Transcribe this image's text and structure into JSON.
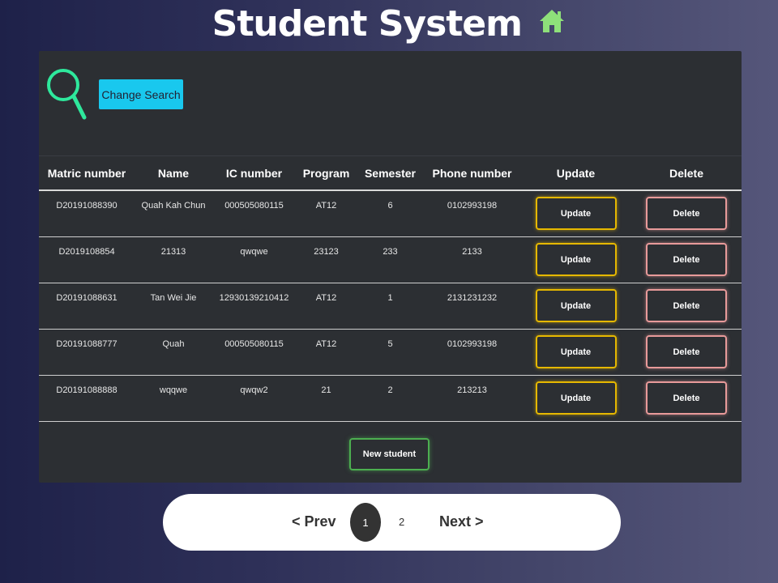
{
  "header": {
    "title": "Student System",
    "icon": "home-icon",
    "icon_color": "#8ee07a"
  },
  "search": {
    "button_label": "Change Search",
    "icon": "search-icon",
    "icon_color": "#2ee89c",
    "button_color": "#19c8ee"
  },
  "table": {
    "columns": [
      "Matric number",
      "Name",
      "IC number",
      "Program",
      "Semester",
      "Phone number",
      "Update",
      "Delete"
    ],
    "rows": [
      {
        "matric": "D20191088390",
        "name": "Quah Kah Chun",
        "ic": "000505080115",
        "program": "AT12",
        "semester": "6",
        "phone": "0102993198",
        "update_label": "Update",
        "delete_label": "Delete"
      },
      {
        "matric": "D2019108854",
        "name": "21313",
        "ic": "qwqwe",
        "program": "23123",
        "semester": "233",
        "phone": "2133",
        "update_label": "Update",
        "delete_label": "Delete"
      },
      {
        "matric": "D20191088631",
        "name": "Tan Wei Jie",
        "ic": "12930139210412",
        "program": "AT12",
        "semester": "1",
        "phone": "2131231232",
        "update_label": "Update",
        "delete_label": "Delete"
      },
      {
        "matric": "D20191088777",
        "name": "Quah",
        "ic": "000505080115",
        "program": "AT12",
        "semester": "5",
        "phone": "0102993198",
        "update_label": "Update",
        "delete_label": "Delete"
      },
      {
        "matric": "D20191088888",
        "name": "wqqwe",
        "ic": "qwqw2",
        "program": "21",
        "semester": "2",
        "phone": "213213",
        "update_label": "Update",
        "delete_label": "Delete"
      }
    ]
  },
  "actions": {
    "new_student_label": "New student"
  },
  "pagination": {
    "prev_label": "< Prev",
    "next_label": "Next >",
    "pages": [
      "1",
      "2"
    ],
    "current_page": "1"
  },
  "colors": {
    "update_border": "#e6b800",
    "delete_border": "#e89a9a",
    "new_border": "#4caf50"
  }
}
